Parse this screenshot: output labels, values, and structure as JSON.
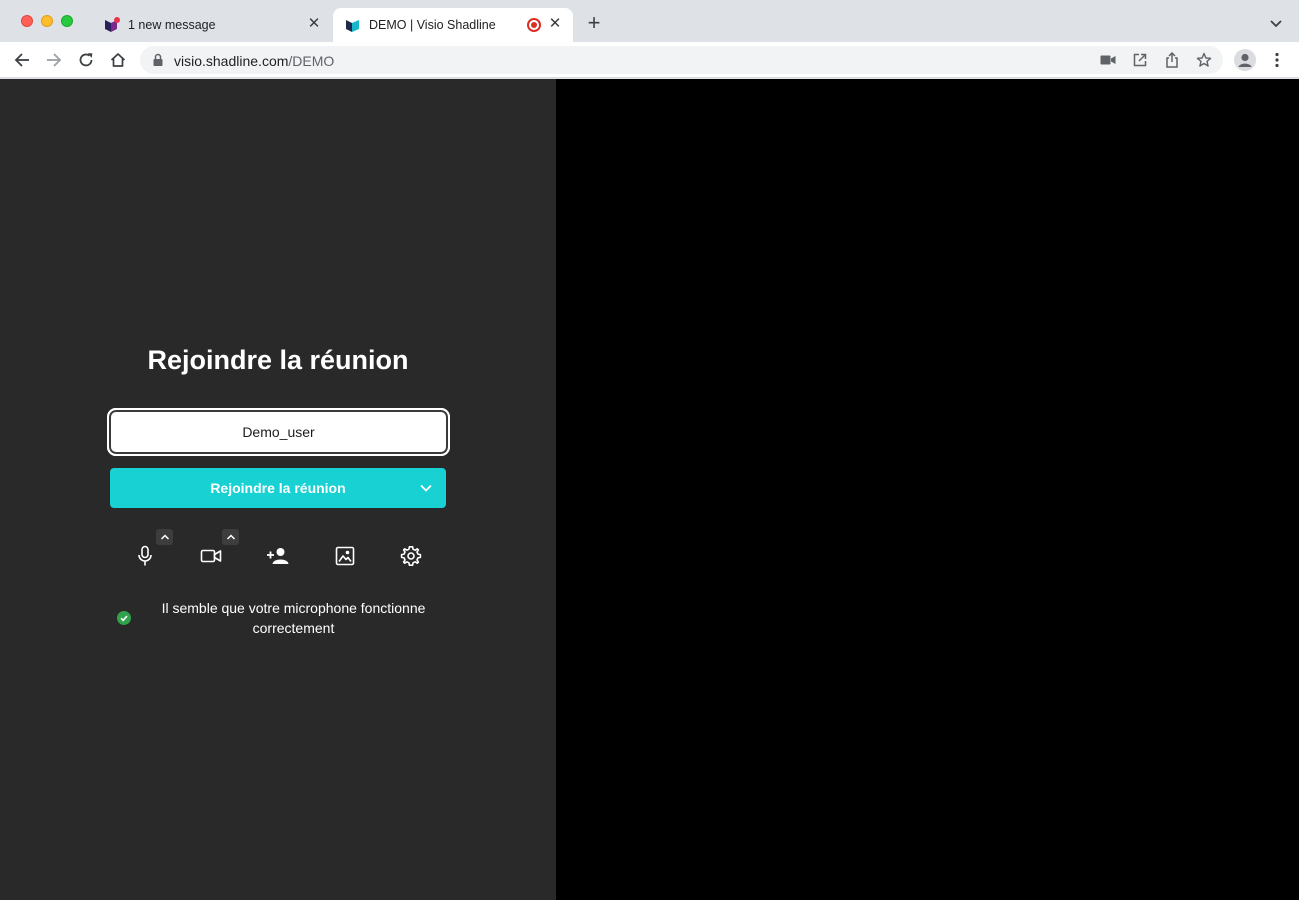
{
  "browser": {
    "tabs": [
      {
        "title": "1 new message",
        "active": false
      },
      {
        "title": "DEMO | Visio Shadline",
        "active": true
      }
    ],
    "url": {
      "host": "visio.shadline.com",
      "path": "/DEMO"
    },
    "close_glyph": "✕",
    "newtab_glyph": "+"
  },
  "join": {
    "heading": "Rejoindre la réunion",
    "name_value": "Demo_user",
    "button_label": "Rejoindre la réunion",
    "mic_status": "Il semble que votre microphone fonctionne correctement"
  },
  "colors": {
    "accent": "#17d1d3",
    "panel": "#292929",
    "stage": "#000000",
    "status_ok": "#31a24c",
    "record": "#d93025"
  }
}
